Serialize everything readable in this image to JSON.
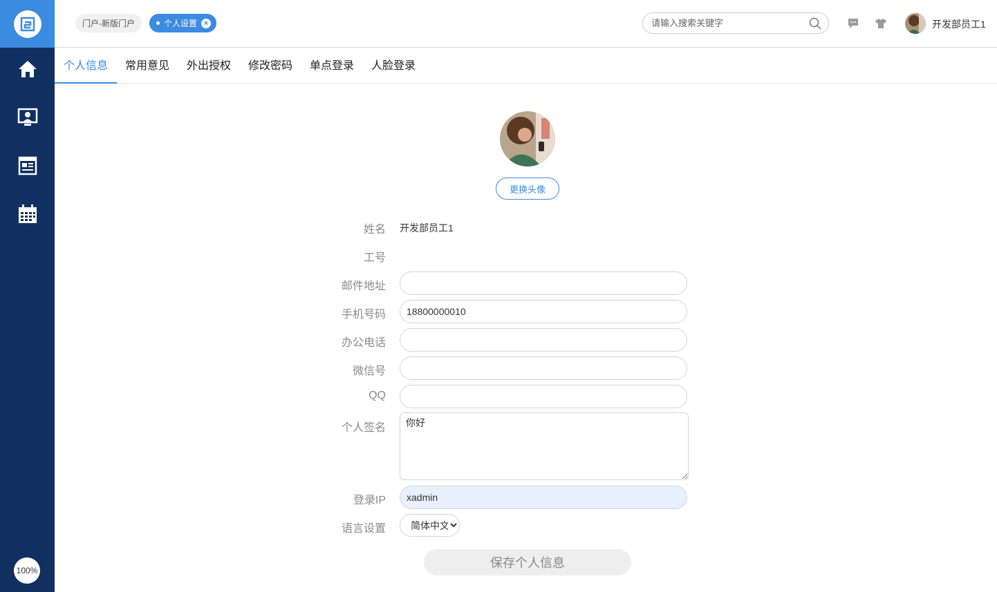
{
  "sidebar": {
    "logo_icon": "app-logo-icon",
    "items": [
      {
        "icon": "home-icon"
      },
      {
        "icon": "user-monitor-icon"
      },
      {
        "icon": "news-icon"
      },
      {
        "icon": "calendar-icon"
      }
    ],
    "zoom": "100%"
  },
  "topbar": {
    "tags": [
      {
        "label": "门户-新版门户"
      },
      {
        "label": "个人设置"
      }
    ],
    "search": {
      "placeholder": "请输入搜索关键字"
    },
    "username": "开发部员工1"
  },
  "tabs": [
    {
      "label": "个人信息"
    },
    {
      "label": "常用意见"
    },
    {
      "label": "外出授权"
    },
    {
      "label": "修改密码"
    },
    {
      "label": "单点登录"
    },
    {
      "label": "人脸登录"
    }
  ],
  "profile": {
    "change_avatar": "更换头像",
    "fields": {
      "name_label": "姓名",
      "name_value": "开发部员工1",
      "id_label": "工号",
      "email_label": "邮件地址",
      "email_value": "",
      "phone_label": "手机号码",
      "phone_value": "18800000010",
      "office_label": "办公电话",
      "office_value": "",
      "wechat_label": "微信号",
      "wechat_value": "",
      "qq_label": "QQ",
      "qq_value": "",
      "signature_label": "个人签名",
      "signature_value": "你好",
      "ip_label": "登录IP",
      "ip_value": "xadmin",
      "language_label": "语言设置",
      "language_value": "简体中文"
    },
    "save_label": "保存个人信息"
  },
  "colors": {
    "sidebar": "#0f3061",
    "accent": "#3b8be0"
  }
}
